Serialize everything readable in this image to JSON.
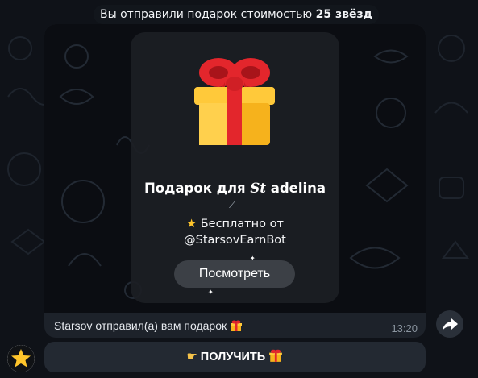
{
  "banner": {
    "text_prefix": "Вы отправили подарок стоимостью",
    "amount": "25 звёзд"
  },
  "gift_card": {
    "title_prefix": "Подарок для",
    "title_script": "St",
    "title_name": "adelina",
    "subtitle_line1": "Бесплатно от",
    "subtitle_line2": "@StarsovEarnBot",
    "view_button_label": "Посмотреть"
  },
  "message": {
    "caption": "Starsov отправил(а) вам подарок",
    "time": "13:20"
  },
  "inline_button": {
    "label": "ПОЛУЧИТЬ"
  },
  "icons": {
    "gift": "gift-icon",
    "star": "star-icon",
    "wand": "magic-wand-icon",
    "hand": "pointing-hand-icon",
    "share": "share-arrow-icon",
    "avatar": "star-avatar-icon"
  },
  "colors": {
    "gift_box": "#f6b21c",
    "gift_ribbon": "#e3262c",
    "star": "#ffc52b",
    "bubble": "#1d222a"
  }
}
